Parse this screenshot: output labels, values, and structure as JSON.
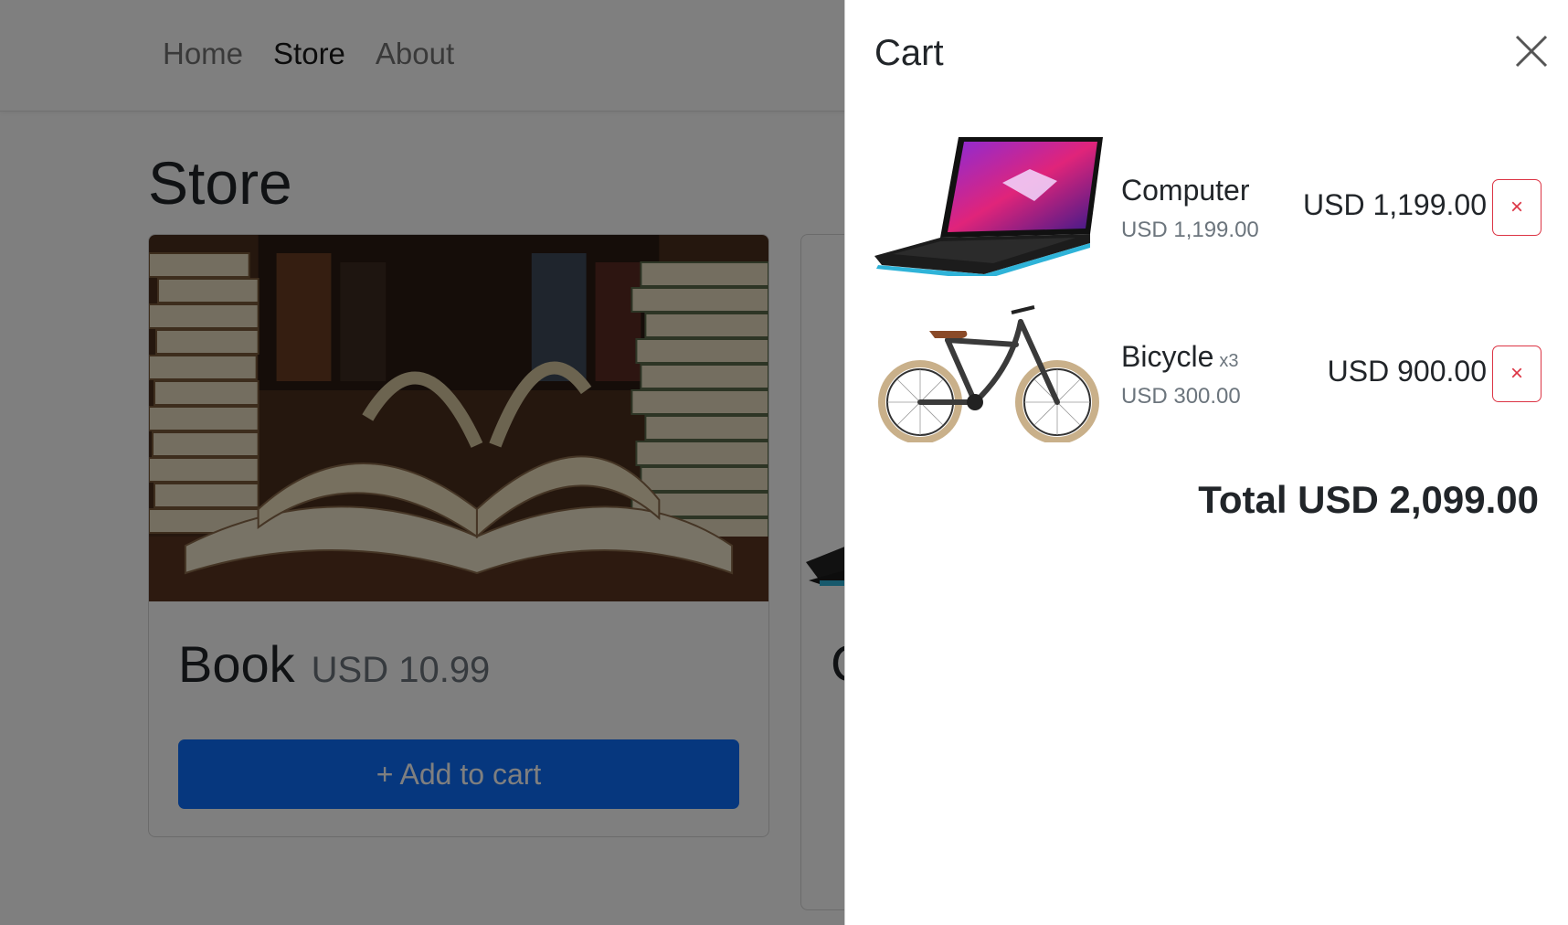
{
  "nav": {
    "links": [
      {
        "label": "Home"
      },
      {
        "label": "Store"
      },
      {
        "label": "About"
      }
    ]
  },
  "store": {
    "title": "Store",
    "products": [
      {
        "name": "Book",
        "price": "USD 10.99",
        "add_label": "+ Add to cart",
        "image": "open-book-photo"
      },
      {
        "name": "C",
        "image": "laptop-photo"
      }
    ]
  },
  "cart": {
    "title": "Cart",
    "close_icon": "close-icon",
    "items": [
      {
        "name": "Computer",
        "qty": "",
        "unit_price": "USD 1,199.00",
        "line_total": "USD 1,199.00",
        "remove_label": "×",
        "image": "laptop-photo"
      },
      {
        "name": "Bicycle",
        "qty": "x3",
        "unit_price": "USD 300.00",
        "line_total": "USD 900.00",
        "remove_label": "×",
        "image": "bicycle-photo"
      }
    ],
    "total_label": "Total USD 2,099.00"
  },
  "colors": {
    "primary": "#0d6efd",
    "danger": "#dc3545",
    "backdrop": "rgba(0,0,0,0.5)"
  }
}
